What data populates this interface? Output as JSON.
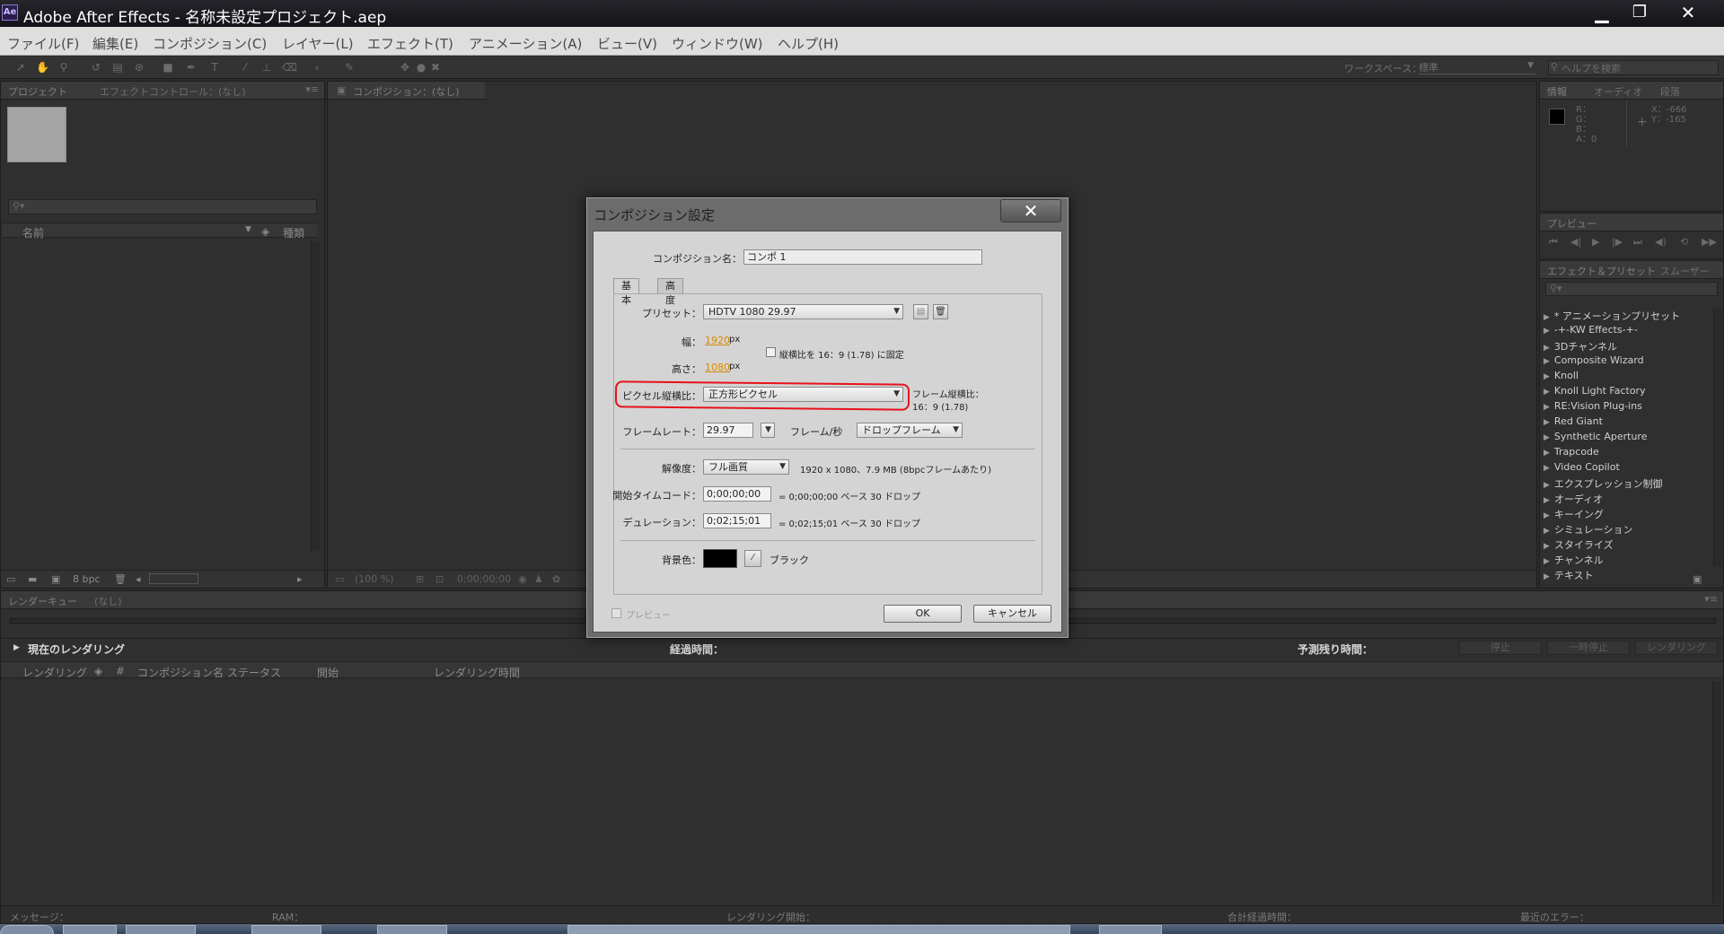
{
  "window": {
    "app_icon": "Ae",
    "title": "Adobe After Effects - 名称未設定プロジェクト.aep",
    "minimize_icon": "minimize-icon",
    "maximize_icon": "restore-icon",
    "close_icon": "close-icon"
  },
  "menu": [
    "ファイル(F)",
    "編集(E)",
    "コンポジション(C)",
    "レイヤー(L)",
    "エフェクト(T)",
    "アニメーション(A)",
    "ビュー(V)",
    "ウィンドウ(W)",
    "ヘルプ(H)"
  ],
  "toolbar": {
    "workspace_label": "ワークスペース：",
    "workspace_value": "標準",
    "help_placeholder": "ヘルプを検索"
  },
  "project_panel": {
    "tabs": [
      "プロジェクト",
      "エフェクトコントロール：(なし)"
    ],
    "columns": {
      "name": "名前",
      "type": "種類"
    },
    "bpc": "8 bpc"
  },
  "composition_panel": {
    "tab": "コンポジション：(なし)",
    "zoom": "(100 %)",
    "timecode": "0;00;00;00"
  },
  "info_panel": {
    "tabs": [
      "情報",
      "オーディオ",
      "段落"
    ],
    "rgba": [
      "R：",
      "G：",
      "B：",
      "A：0"
    ],
    "x": "X：-666",
    "y": "Y：-165"
  },
  "preview_panel": {
    "tab": "プレビュー"
  },
  "effects_panel": {
    "tabs": [
      "エフェクト＆プリセット",
      "スムーザー"
    ],
    "items": [
      "* アニメーションプリセット",
      "-+-KW Effects-+-",
      "3Dチャンネル",
      "Composite Wizard",
      "Knoll",
      "Knoll Light Factory",
      "RE:Vision Plug-ins",
      "Red Giant",
      "Synthetic Aperture",
      "Trapcode",
      "Video Copilot",
      "エクスプレッション制御",
      "オーディオ",
      "キーイング",
      "シミュレーション",
      "スタイライズ",
      "チャンネル",
      "テキスト"
    ]
  },
  "render_queue": {
    "tabs": [
      "レンダーキュー",
      "(なし)"
    ],
    "current": "現在のレンダリング",
    "elapsed": "経過時間：",
    "remaining": "予測残り時間：",
    "buttons": [
      "停止",
      "一時停止",
      "レンダリング"
    ],
    "columns": [
      "レンダリング",
      "#",
      "コンポジション名",
      "ステータス",
      "開始",
      "レンダリング時間"
    ],
    "status": {
      "message": "メッセージ：",
      "ram": "RAM：",
      "render_start": "レンダリング開始：",
      "total_elapsed": "合計経過時間：",
      "last_error": "最近のエラー："
    }
  },
  "dialog": {
    "title": "コンポジション設定",
    "name_label": "コンポジション名：",
    "name_value": "コンポ 1",
    "tabs": [
      "基本",
      "高度"
    ],
    "preset_label": "プリセット：",
    "preset_value": "HDTV 1080 29.97",
    "width_label": "幅：",
    "width_value": "1920",
    "height_label": "高さ：",
    "height_value": "1080",
    "px": "px",
    "lock_aspect": "縦横比を 16：9 (1.78) に固定",
    "pixel_aspect_label": "ピクセル縦横比：",
    "pixel_aspect_value": "正方形ピクセル",
    "frame_aspect_label": "フレーム縦横比：",
    "frame_aspect_value": "16：9 (1.78)",
    "framerate_label": "フレームレート：",
    "framerate_value": "29.97",
    "fps_unit": "フレーム/秒",
    "drop_frame": "ドロップフレーム",
    "resolution_label": "解像度：",
    "resolution_value": "フル画質",
    "resolution_info": "1920 x 1080、7.9 MB (8bpcフレームあたり)",
    "start_tc_label": "開始タイムコード：",
    "start_tc_value": "0;00;00;00",
    "start_tc_info": "= 0;00;00;00  ベース 30 ドロップ",
    "duration_label": "デュレーション：",
    "duration_value": "0;02;15;01",
    "duration_info": "= 0;02;15;01  ベース 30 ドロップ",
    "bg_label": "背景色：",
    "bg_color": "#000000",
    "bg_name": "ブラック",
    "preview_label": "プレビュー",
    "ok": "OK",
    "cancel": "キャンセル",
    "highlight_color": "#e8111a"
  }
}
